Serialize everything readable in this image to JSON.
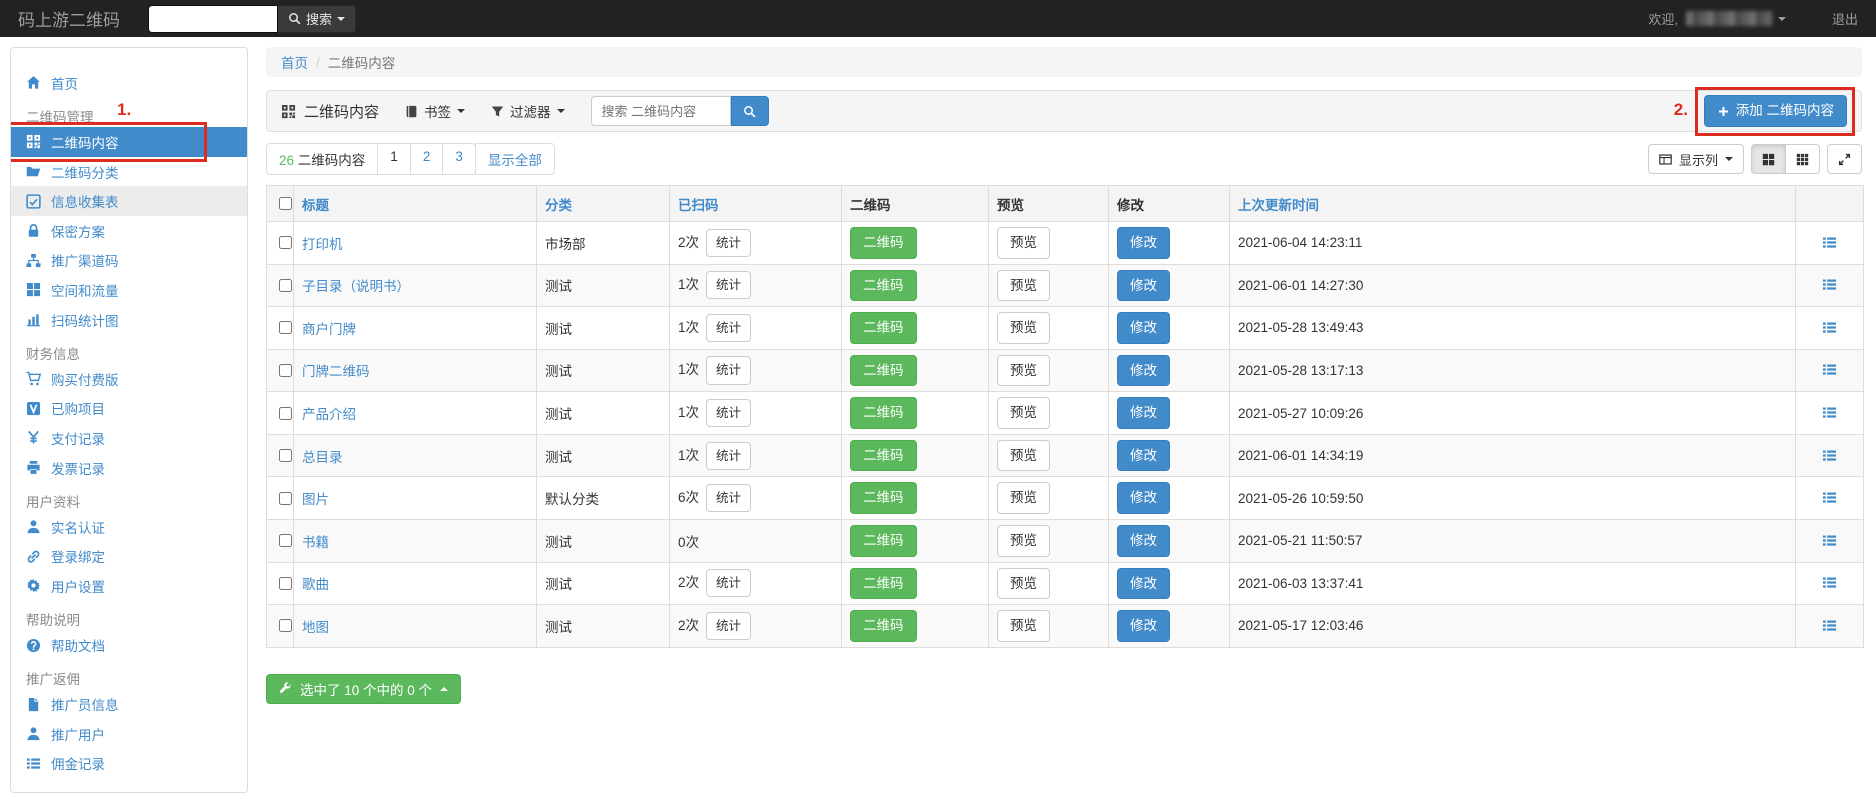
{
  "colors": {
    "accent": "#428bca",
    "success": "#5cb85c",
    "annotation_red": "#dd2b20",
    "navbar_bg": "#222222"
  },
  "topbar": {
    "brand": "码上游二维码",
    "search_placeholder": "",
    "search_label": "搜索",
    "welcome": "欢迎,",
    "logout": "退出"
  },
  "sidebar": {
    "items": [
      {
        "kind": "link",
        "icon": "home",
        "label": "首页"
      },
      {
        "kind": "section",
        "label": "二维码管理"
      },
      {
        "kind": "link",
        "icon": "qrcode",
        "label": "二维码内容",
        "active": true,
        "annotation": "1."
      },
      {
        "kind": "link",
        "icon": "folder",
        "label": "二维码分类"
      },
      {
        "kind": "link",
        "icon": "check-square",
        "label": "信息收集表",
        "highlight": true
      },
      {
        "kind": "link",
        "icon": "lock",
        "label": "保密方案"
      },
      {
        "kind": "link",
        "icon": "sitemap",
        "label": "推广渠道码"
      },
      {
        "kind": "link",
        "icon": "th-large",
        "label": "空间和流量"
      },
      {
        "kind": "link",
        "icon": "bar-chart",
        "label": "扫码统计图"
      },
      {
        "kind": "section",
        "label": "财务信息"
      },
      {
        "kind": "link",
        "icon": "cart",
        "label": "购买付费版"
      },
      {
        "kind": "link",
        "icon": "v-square",
        "label": "已购项目"
      },
      {
        "kind": "link",
        "icon": "yen",
        "label": "支付记录"
      },
      {
        "kind": "link",
        "icon": "print",
        "label": "发票记录"
      },
      {
        "kind": "section",
        "label": "用户资料"
      },
      {
        "kind": "link",
        "icon": "user",
        "label": "实名认证"
      },
      {
        "kind": "link",
        "icon": "link",
        "label": "登录绑定"
      },
      {
        "kind": "link",
        "icon": "gear",
        "label": "用户设置"
      },
      {
        "kind": "section",
        "label": "帮助说明"
      },
      {
        "kind": "link",
        "icon": "question",
        "label": "帮助文档"
      },
      {
        "kind": "section",
        "label": "推广返佣"
      },
      {
        "kind": "link",
        "icon": "file",
        "label": "推广员信息"
      },
      {
        "kind": "link",
        "icon": "user",
        "label": "推广用户"
      },
      {
        "kind": "link",
        "icon": "list",
        "label": "佣金记录"
      }
    ]
  },
  "breadcrumb": {
    "home": "首页",
    "sep": "/",
    "current": "二维码内容"
  },
  "toolbar": {
    "title": "二维码内容",
    "bookmarks_label": "书签",
    "filter_label": "过滤器",
    "search_placeholder": "搜索 二维码内容",
    "add_label": "添加 二维码内容"
  },
  "annotations": {
    "one": "1.",
    "two": "2."
  },
  "pagination": {
    "count": "26",
    "count_label": "二维码内容",
    "pages": [
      {
        "label": "1",
        "active": true
      },
      {
        "label": "2"
      },
      {
        "label": "3"
      }
    ],
    "show_all": "显示全部"
  },
  "view_controls": {
    "columns_label": "显示列"
  },
  "table": {
    "headers": {
      "title": "标题",
      "category": "分类",
      "scans": "已扫码",
      "qr": "二维码",
      "preview": "预览",
      "edit": "修改",
      "updated": "上次更新时间"
    },
    "buttons": {
      "qr": "二维码",
      "stats": "统计",
      "preview": "预览",
      "edit": "修改"
    },
    "rows": [
      {
        "title": "打印机",
        "category": "市场部",
        "scans": "2次",
        "has_stats": true,
        "updated": "2021-06-04 14:23:11"
      },
      {
        "title": "子目录（说明书）",
        "category": "测试",
        "scans": "1次",
        "has_stats": true,
        "updated": "2021-06-01 14:27:30"
      },
      {
        "title": "商户门牌",
        "category": "测试",
        "scans": "1次",
        "has_stats": true,
        "updated": "2021-05-28 13:49:43"
      },
      {
        "title": "门牌二维码",
        "category": "测试",
        "scans": "1次",
        "has_stats": true,
        "updated": "2021-05-28 13:17:13"
      },
      {
        "title": "产品介绍",
        "category": "测试",
        "scans": "1次",
        "has_stats": true,
        "updated": "2021-05-27 10:09:26"
      },
      {
        "title": "总目录",
        "category": "测试",
        "scans": "1次",
        "has_stats": true,
        "updated": "2021-06-01 14:34:19"
      },
      {
        "title": "图片",
        "category": "默认分类",
        "scans": "6次",
        "has_stats": true,
        "updated": "2021-05-26 10:59:50"
      },
      {
        "title": "书籍",
        "category": "测试",
        "scans": "0次",
        "has_stats": false,
        "updated": "2021-05-21 11:50:57"
      },
      {
        "title": "歌曲",
        "category": "测试",
        "scans": "2次",
        "has_stats": true,
        "updated": "2021-06-03 13:37:41"
      },
      {
        "title": "地图",
        "category": "测试",
        "scans": "2次",
        "has_stats": true,
        "updated": "2021-05-17 12:03:46"
      }
    ]
  },
  "footer": {
    "bulk_label": "选中了 10 个中的 0 个"
  }
}
